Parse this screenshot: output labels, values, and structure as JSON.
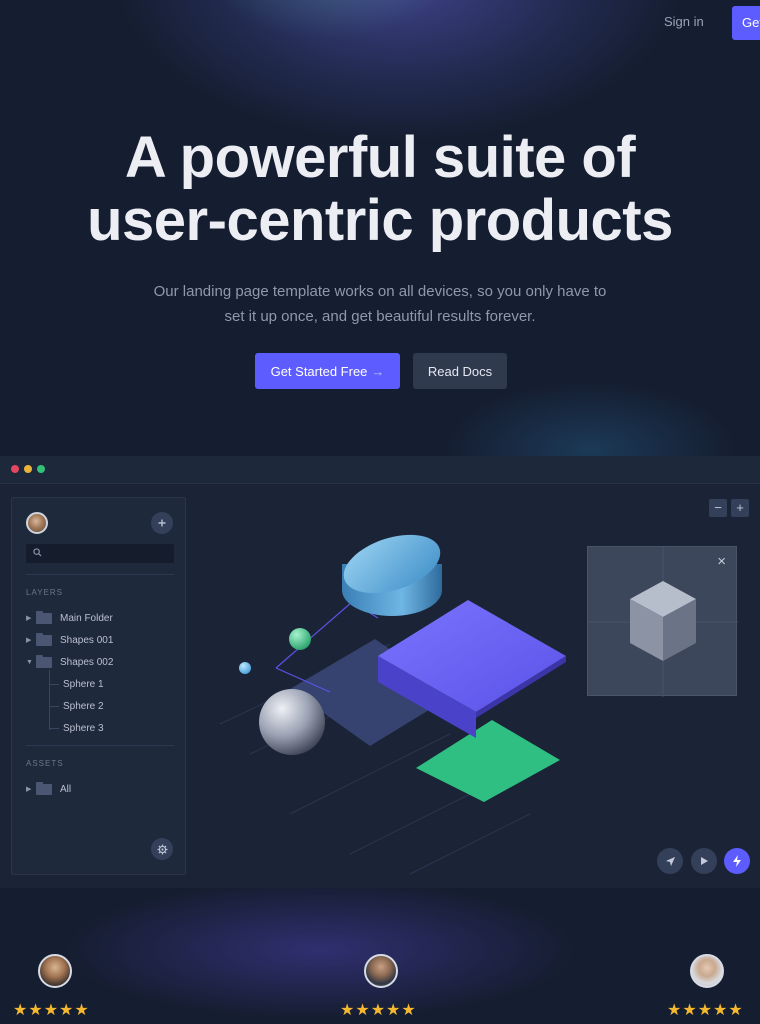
{
  "header": {
    "signin_label": "Sign in",
    "cta_label": "Get"
  },
  "hero": {
    "title_line1": "A powerful suite of",
    "title_line2": "user-centric products",
    "subtitle_line1": "Our landing page template works on all devices, so you only have to",
    "subtitle_line2": "set it up once, and get beautiful results forever.",
    "primary_button": "Get Started Free",
    "primary_arrow": "→",
    "secondary_button": "Read Docs"
  },
  "app": {
    "sidebar": {
      "layers_heading": "LAYERS",
      "layers": [
        {
          "label": "Main Folder",
          "caret": "▶"
        },
        {
          "label": "Shapes 001",
          "caret": "▶"
        },
        {
          "label": "Shapes 002",
          "caret": "▼"
        }
      ],
      "children": [
        "Sphere 1",
        "Sphere 2",
        "Sphere 3"
      ],
      "assets_heading": "ASSETS",
      "assets": [
        {
          "label": "All",
          "caret": "▶"
        }
      ]
    },
    "zoom": {
      "minus": "−",
      "plus": "+"
    },
    "preview_close": "×",
    "tools": [
      "navigate-icon",
      "play-icon",
      "bolt-icon"
    ]
  },
  "testimonials": [
    {
      "stars": "★★★★★"
    },
    {
      "stars": "★★★★★"
    },
    {
      "stars": "★★★★★"
    }
  ],
  "colors": {
    "background": "#151d30",
    "accent": "#5d5dff",
    "star": "#f5b82e",
    "green_plane": "#2fbf82"
  }
}
